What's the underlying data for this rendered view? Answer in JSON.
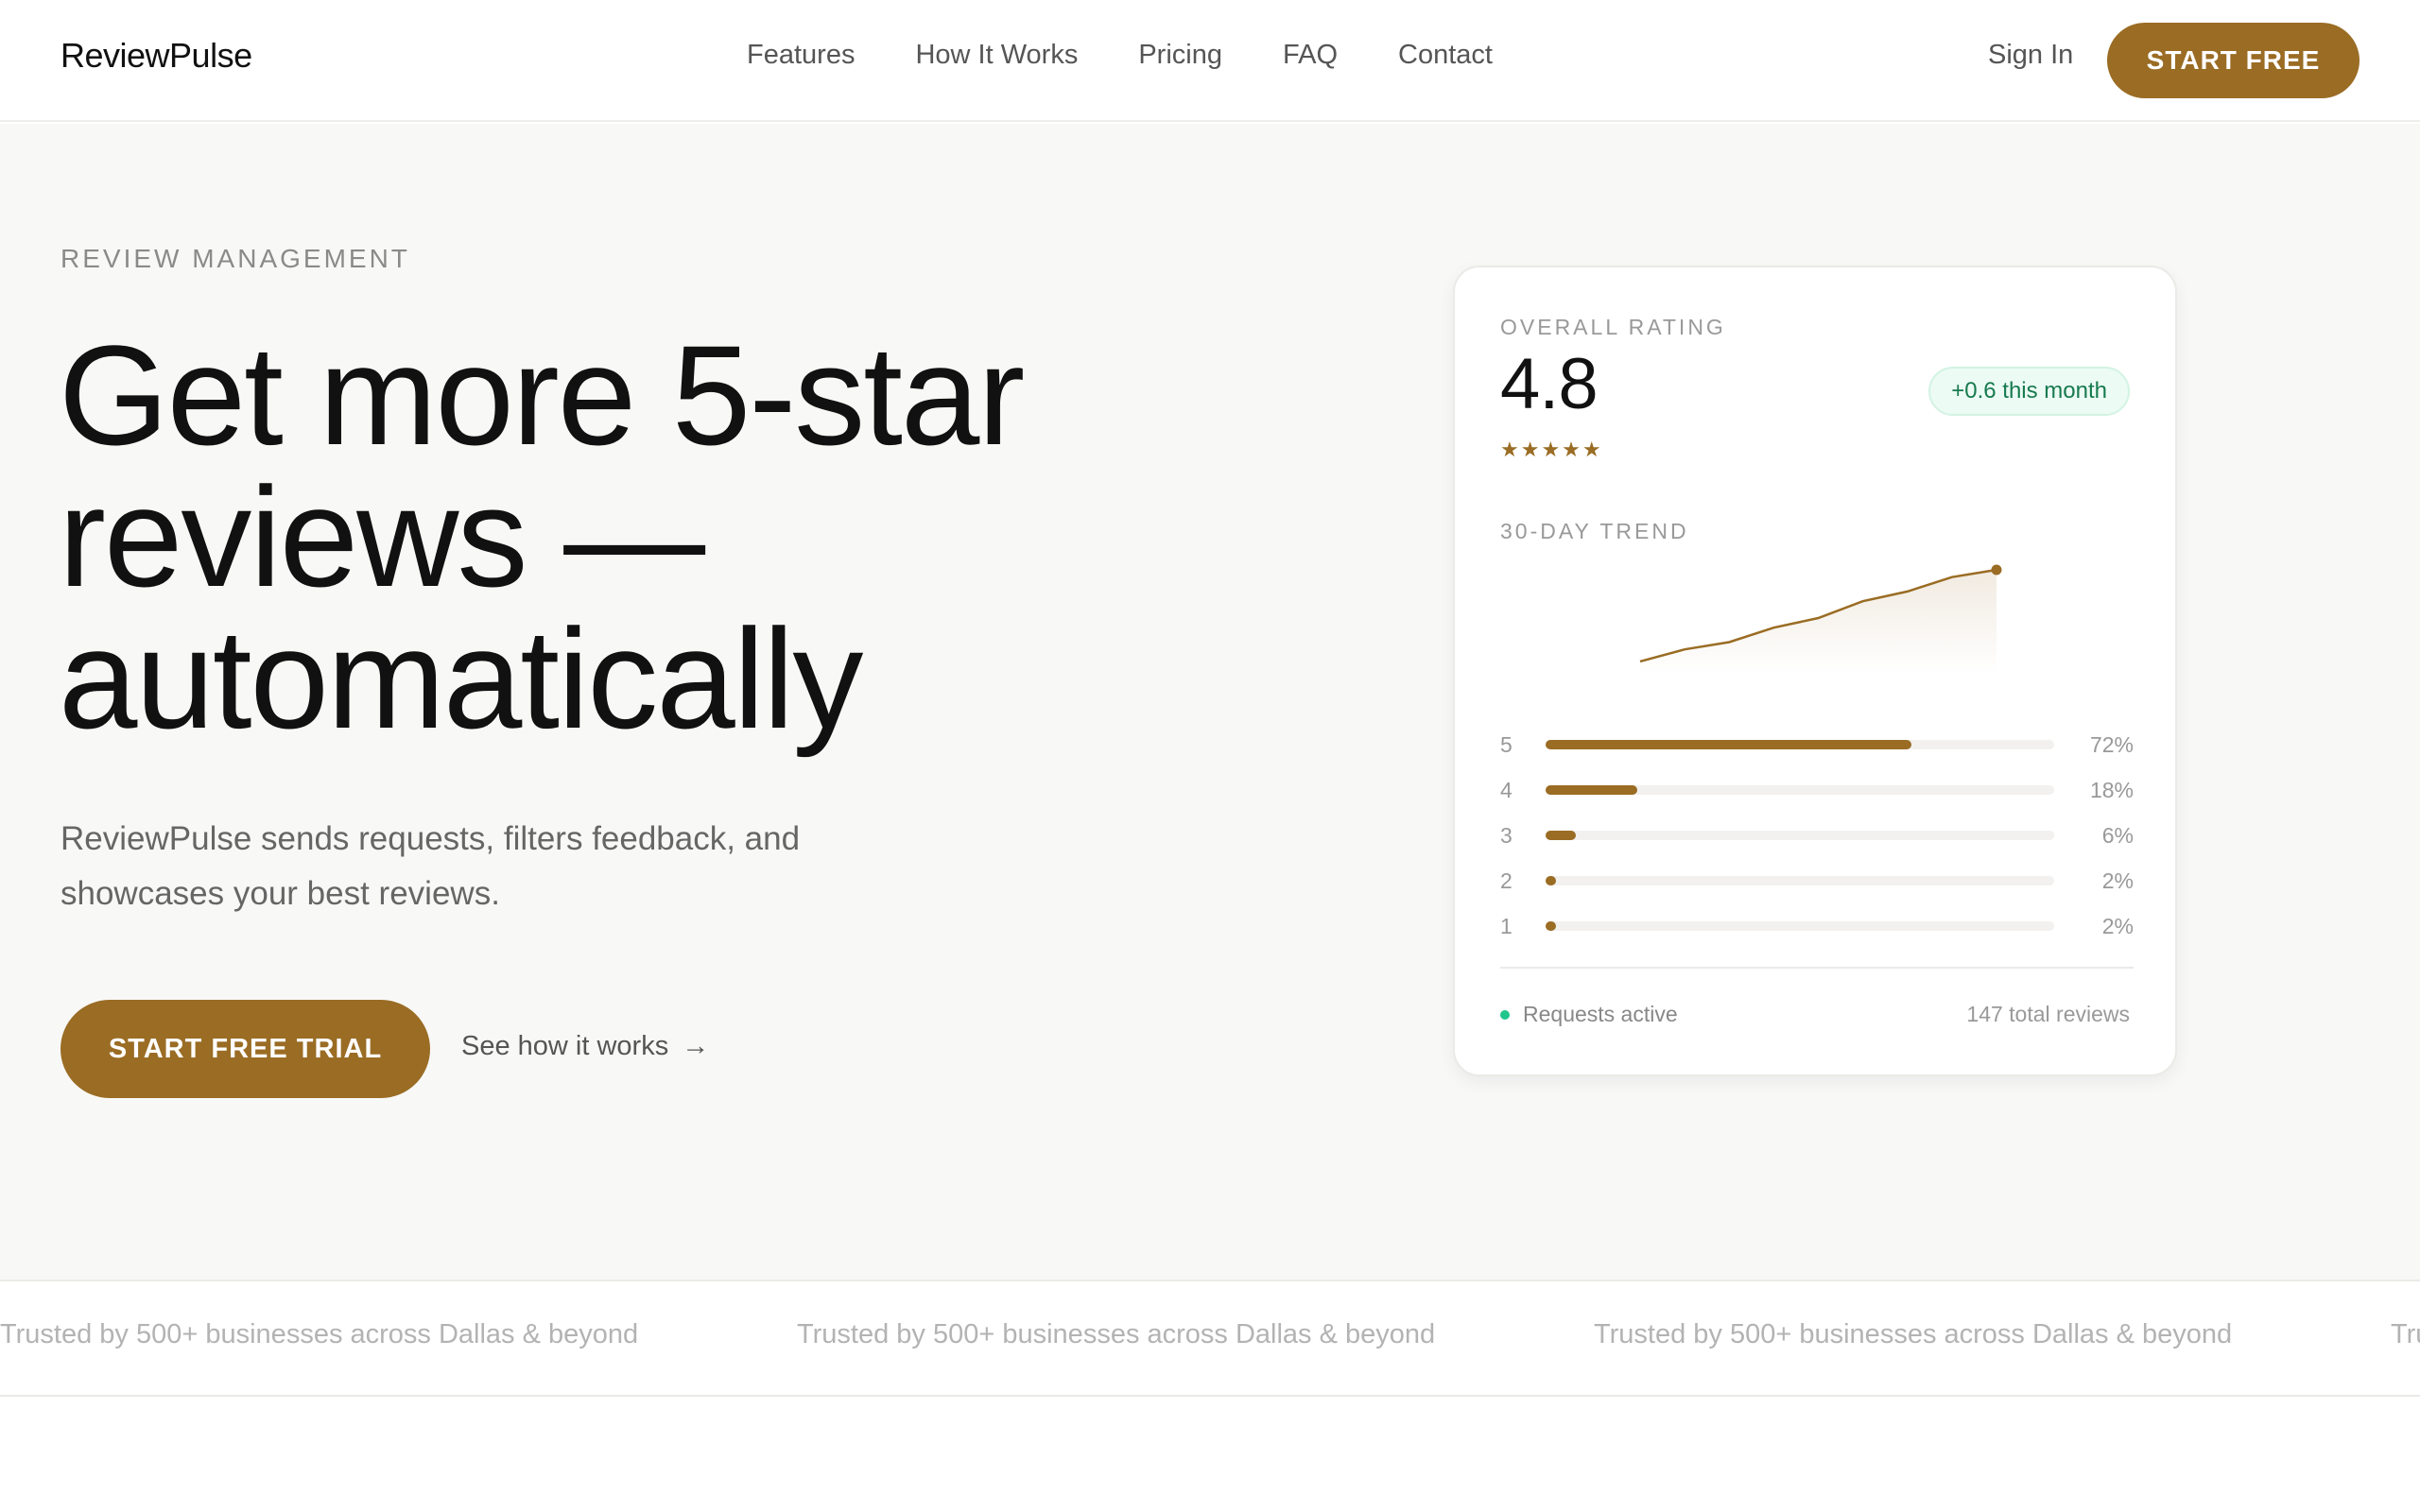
{
  "nav": {
    "logo": "ReviewPulse",
    "links": [
      "Features",
      "How It Works",
      "Pricing",
      "FAQ",
      "Contact"
    ],
    "sign_in": "Sign In",
    "cta": "START FREE"
  },
  "hero": {
    "eyebrow": "REVIEW MANAGEMENT",
    "headline": [
      "Get more 5-star",
      "reviews —",
      "automatically"
    ],
    "subtext": "ReviewPulse sends requests, filters feedback, and showcases your best reviews.",
    "primary_cta": "START FREE TRIAL",
    "secondary_cta": "See how it works",
    "secondary_arrow": "→"
  },
  "card": {
    "overall_label": "OVERALL RATING",
    "rating": "4.8",
    "stars": "★★★★★",
    "badge": "+0.6 this month",
    "trend_label": "30-DAY TREND",
    "trend_values": [
      4.2,
      4.25,
      4.28,
      4.34,
      4.38,
      4.45,
      4.49,
      4.55,
      4.58
    ],
    "distribution": [
      {
        "stars": "5",
        "pct": 72,
        "label": "72%"
      },
      {
        "stars": "4",
        "pct": 18,
        "label": "18%"
      },
      {
        "stars": "3",
        "pct": 6,
        "label": "6%"
      },
      {
        "stars": "2",
        "pct": 2,
        "label": "2%"
      },
      {
        "stars": "1",
        "pct": 2,
        "label": "2%"
      }
    ],
    "status": "Requests active",
    "total": "147 total reviews"
  },
  "strip": {
    "text": "Trusted by 500+ businesses across Dallas & beyond"
  },
  "colors": {
    "accent": "#9a6c24",
    "badge_bg": "#ecfbf4",
    "badge_text": "#177a4e",
    "status_dot": "#22c58b"
  }
}
